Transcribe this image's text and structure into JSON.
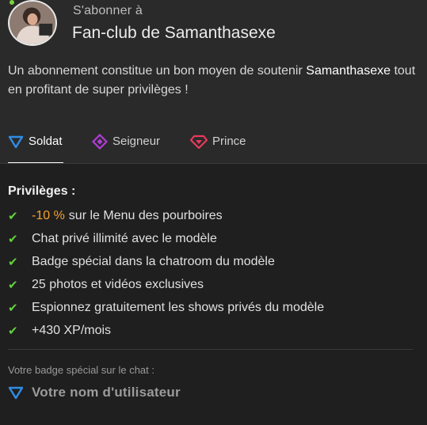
{
  "header": {
    "subtitle": "S'abonner à",
    "title": "Fan-club de Samanthasexe",
    "description_pre": "Un abonnement constitue un bon moyen de soutenir",
    "description_name": "Samanthasexe",
    "description_post": "tout en profitant de super privilèges !"
  },
  "tabs": [
    {
      "label": "Soldat",
      "icon": "triangle-down-icon",
      "color": "#2f8de6",
      "active": true
    },
    {
      "label": "Seigneur",
      "icon": "diamond-icon",
      "color": "#b33bd9",
      "active": false
    },
    {
      "label": "Prince",
      "icon": "gem-icon",
      "color": "#e83a5c",
      "active": false
    }
  ],
  "privileges": {
    "title": "Privilèges :",
    "items": [
      {
        "accent": "-10 %",
        "text": "sur le Menu des pourboires"
      },
      {
        "accent": "",
        "text": "Chat privé illimité avec le modèle"
      },
      {
        "accent": "",
        "text": "Badge spécial dans la chatroom du modèle"
      },
      {
        "accent": "",
        "text": "25 photos et vidéos exclusives"
      },
      {
        "accent": "",
        "text": "Espionnez gratuitement les shows privés du modèle"
      },
      {
        "accent": "",
        "text": "+430 XP/mois"
      }
    ],
    "check_color": "#63d13e",
    "accent_color": "#f5a030"
  },
  "badge": {
    "caption": "Votre badge spécial sur le chat :",
    "username": "Votre nom d'utilisateur",
    "icon": "triangle-down-icon"
  }
}
